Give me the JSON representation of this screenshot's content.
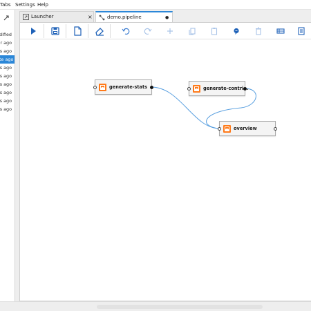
{
  "menu": {
    "items": [
      "Tabs",
      "Settings",
      "Help"
    ]
  },
  "file_browser": {
    "rows": [
      {
        "label": "dified",
        "selected": false
      },
      {
        "label": "ur ago",
        "selected": false
      },
      {
        "label": "es ago",
        "selected": false
      },
      {
        "label": "te ago",
        "selected": true
      },
      {
        "label": "ns ago",
        "selected": false
      },
      {
        "label": "ns ago",
        "selected": false
      },
      {
        "label": "ns ago",
        "selected": false
      },
      {
        "label": "ns ago",
        "selected": false
      },
      {
        "label": "ns ago",
        "selected": false
      },
      {
        "label": "ns ago",
        "selected": false
      }
    ]
  },
  "tabs": [
    {
      "label": "Launcher",
      "icon": "launcher-icon",
      "close": "×",
      "active": false
    },
    {
      "label": "demo.pipeline",
      "icon": "pipeline-icon",
      "close": "●",
      "active": true
    }
  ],
  "toolbar": {
    "buttons": [
      "run-icon",
      "save-icon",
      "clear-icon",
      "eraser-icon",
      "undo-icon",
      "redo-icon",
      "add-icon",
      "copy-icon",
      "paste-icon",
      "comment-icon",
      "delete-icon",
      "arrange-icon",
      "properties-icon"
    ]
  },
  "pipeline": {
    "nodes": [
      {
        "id": "generate-stats",
        "label": "generate-stats"
      },
      {
        "id": "generate-contri",
        "label": "generate-contri..."
      },
      {
        "id": "overview",
        "label": "overview"
      }
    ]
  },
  "colors": {
    "accent": "#2b87d8",
    "node_icon": "#ff7a1a",
    "link": "#5aa0e0"
  }
}
